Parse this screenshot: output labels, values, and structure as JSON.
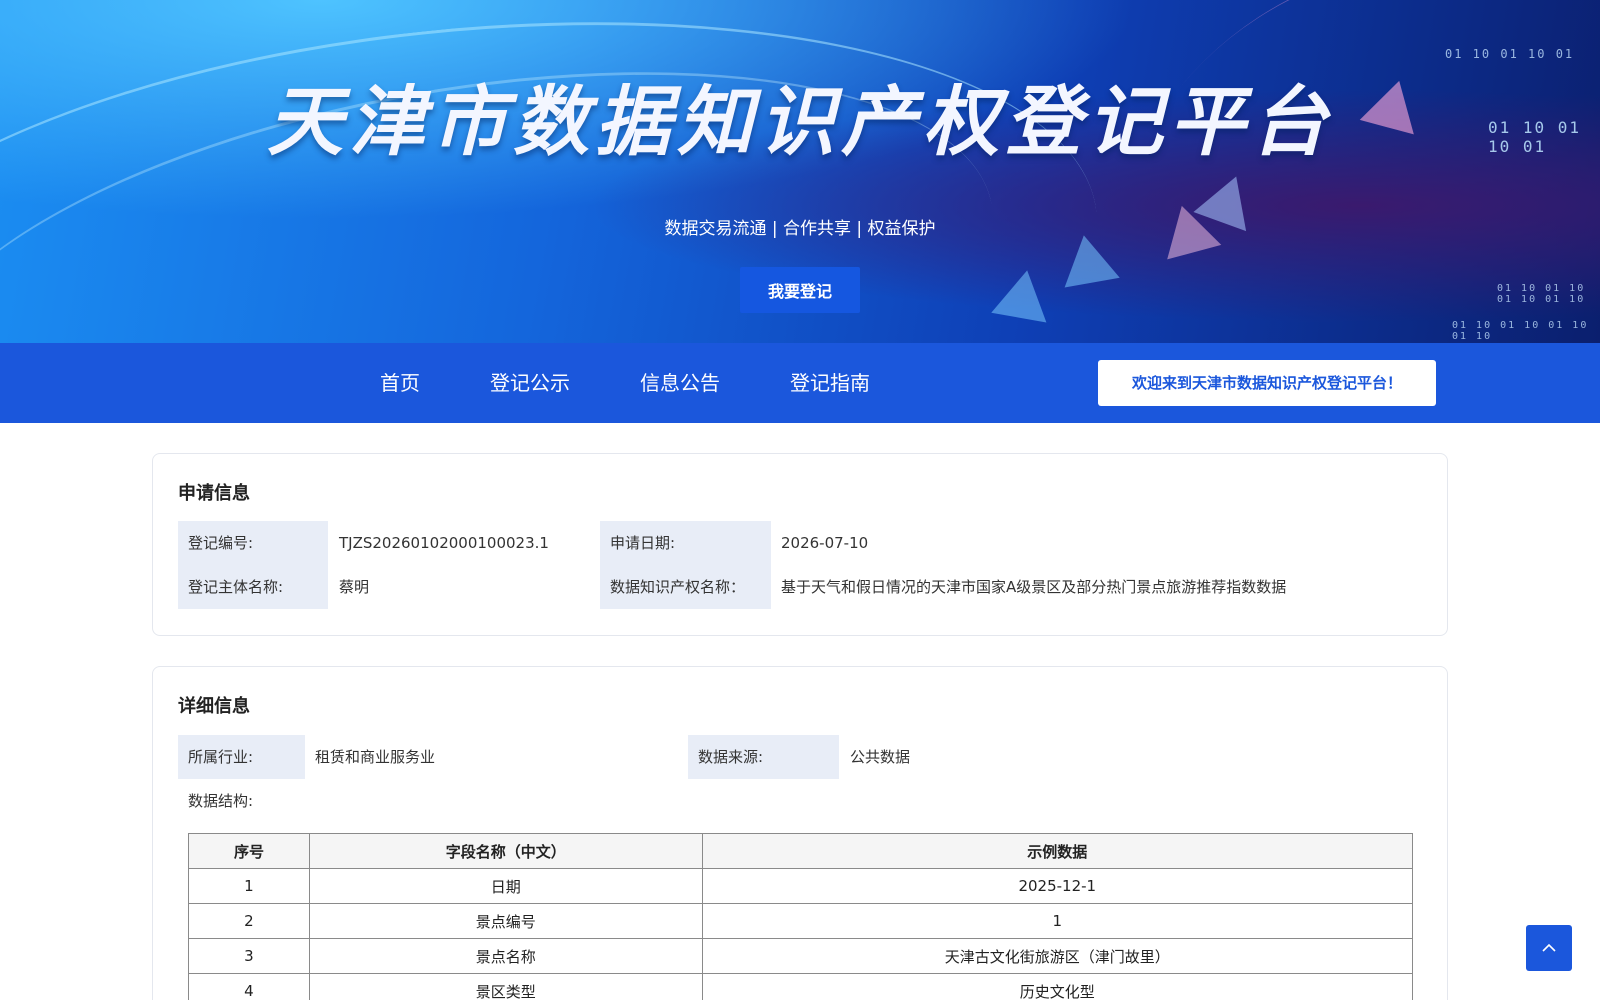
{
  "hero": {
    "title": "天津市数据知识产权登记平台",
    "subtitle": "数据交易流通 | 合作共享 | 权益保护",
    "register_button": "我要登记",
    "binary_rows": [
      "01 10 01 10 01",
      "01 10 01 10 01",
      "01 10 01 10 01 10 01 10",
      "01 10 01 10 01 10 01 10"
    ]
  },
  "nav": {
    "items": [
      "首页",
      "登记公示",
      "信息公告",
      "登记指南"
    ],
    "welcome": "欢迎来到天津市数据知识产权登记平台！"
  },
  "application": {
    "title": "申请信息",
    "fields": [
      {
        "label": "登记编号:",
        "value": "TJZS20260102000100023.1"
      },
      {
        "label": "申请日期:",
        "value": "2026-07-10"
      },
      {
        "label": "登记主体名称:",
        "value": "蔡明"
      },
      {
        "label": "数据知识产权名称：",
        "value": "基于天气和假日情况的天津市国家A级景区及部分热门景点旅游推荐指数数据"
      }
    ]
  },
  "details": {
    "title": "详细信息",
    "industry_label": "所属行业:",
    "industry_value": "租赁和商业服务业",
    "source_label": "数据来源:",
    "source_value": "公共数据",
    "structure_label": "数据结构:",
    "table": {
      "headers": [
        "序号",
        "字段名称（中文）",
        "示例数据"
      ],
      "rows": [
        [
          "1",
          "日期",
          "2025-12-1"
        ],
        [
          "2",
          "景点编号",
          "1"
        ],
        [
          "3",
          "景点名称",
          "天津古文化街旅游区（津门故里）"
        ],
        [
          "4",
          "景区类型",
          "历史文化型"
        ]
      ]
    }
  },
  "colors": {
    "primary": "#1b57dc",
    "label_bg": "#e8edf7"
  }
}
